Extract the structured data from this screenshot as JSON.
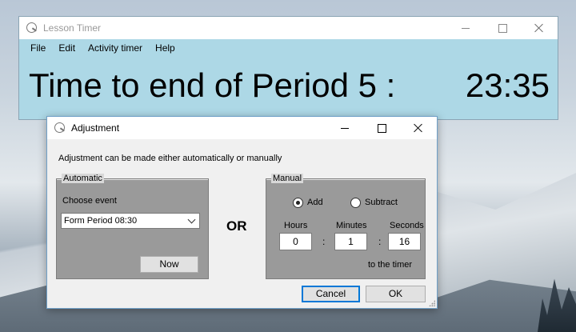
{
  "main_window": {
    "title": "Lesson Timer",
    "menu": [
      "File",
      "Edit",
      "Activity timer",
      "Help"
    ],
    "countdown_label": "Time to end of Period 5 :",
    "countdown_value": "23:35"
  },
  "dialog": {
    "title": "Adjustment",
    "instruction": "Adjustment can be made either automatically or manually",
    "or_label": "OR",
    "automatic": {
      "legend": "Automatic",
      "choose_label": "Choose event",
      "selected_event": "Form Period 08:30",
      "now_button": "Now"
    },
    "manual": {
      "legend": "Manual",
      "add_label": "Add",
      "subtract_label": "Subtract",
      "selected_mode": "Add",
      "hours_label": "Hours",
      "minutes_label": "Minutes",
      "seconds_label": "Seconds",
      "hours": "0",
      "minutes": "1",
      "seconds": "16",
      "colon": ":",
      "to_timer_label": "to the timer"
    },
    "cancel_button": "Cancel",
    "ok_button": "OK"
  },
  "icons": [
    "app-icon",
    "minimize-icon",
    "maximize-icon",
    "close-icon",
    "chevron-down-icon",
    "resize-grip-icon"
  ]
}
